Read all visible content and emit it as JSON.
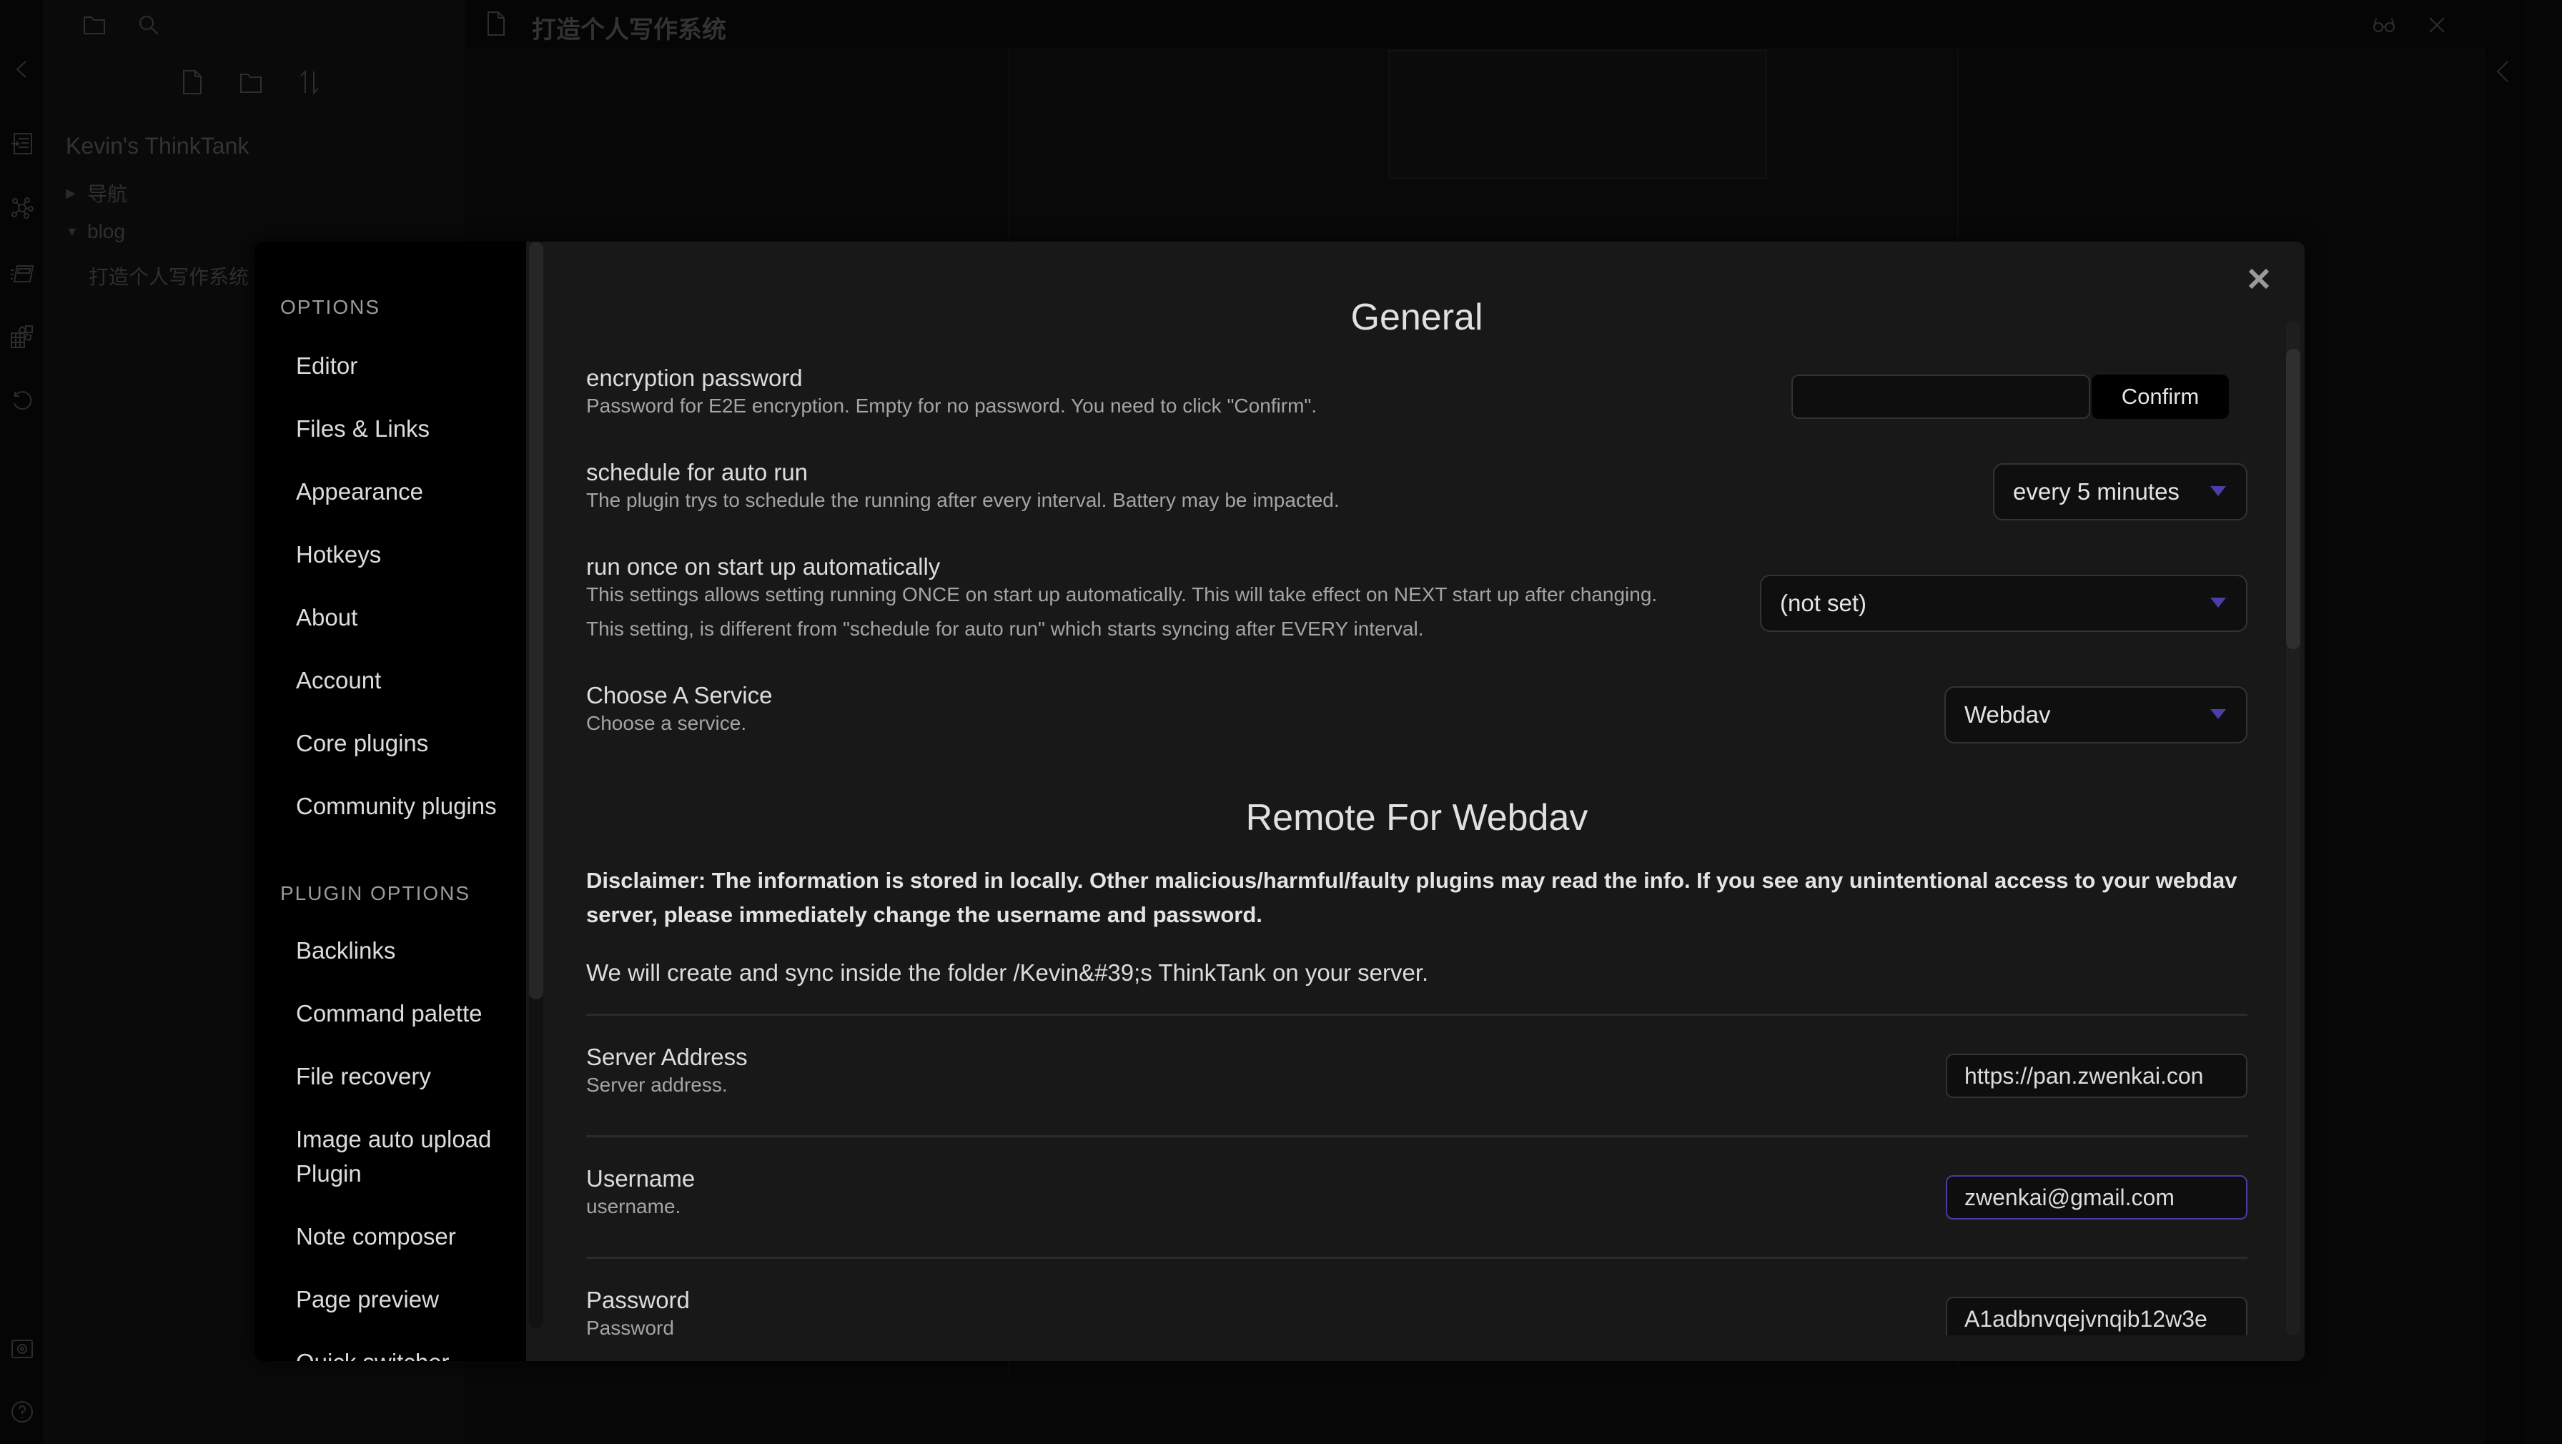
{
  "app": {
    "tab_title": "打造个人写作系统",
    "vault_name": "Kevin's ThinkTank",
    "tree": [
      {
        "label": "导航",
        "expanded": false
      },
      {
        "label": "blog",
        "expanded": true
      },
      {
        "label": "打造个人写作系统",
        "expanded": null
      }
    ]
  },
  "ribbon": {
    "icons": [
      "collapse-left-icon",
      "open-quick-switcher-icon",
      "graph-view-icon",
      "slides-icon",
      "plugin-blocks-icon",
      "history-icon",
      "vault-icon",
      "help-icon"
    ]
  },
  "settings_nav": {
    "options_heading": "OPTIONS",
    "options": [
      "Editor",
      "Files & Links",
      "Appearance",
      "Hotkeys",
      "About",
      "Account",
      "Core plugins",
      "Community plugins"
    ],
    "plugin_heading": "PLUGIN OPTIONS",
    "plugins": [
      "Backlinks",
      "Command palette",
      "File recovery",
      "Image auto upload Plugin",
      "Note composer",
      "Page preview",
      "Quick switcher"
    ]
  },
  "settings": {
    "general_title": "General",
    "encryption": {
      "name": "encryption password",
      "desc": "Password for E2E encryption. Empty for no password. You need to click \"Confirm\".",
      "value": "",
      "button": "Confirm"
    },
    "schedule": {
      "name": "schedule for auto run",
      "desc": "The plugin trys to schedule the running after every interval. Battery may be impacted.",
      "selected": "every 5 minutes"
    },
    "startup": {
      "name": "run once on start up automatically",
      "desc1": "This settings allows setting running ONCE on start up automatically. This will take effect on NEXT start up after changing.",
      "desc2": "This setting, is different from \"schedule for auto run\" which starts syncing after EVERY interval.",
      "selected": "(not set)"
    },
    "service": {
      "name": "Choose A Service",
      "desc": "Choose a service.",
      "selected": "Webdav"
    },
    "remote_title": "Remote For Webdav",
    "disclaimer": "Disclaimer: The information is stored in locally. Other malicious/harmful/faulty plugins may read the info. If you see any unintentional access to your webdav server, please immediately change the username and password.",
    "folder_note": "We will create and sync inside the folder /Kevin&#39;s ThinkTank on your server.",
    "server": {
      "name": "Server Address",
      "desc": "Server address.",
      "value": "https://pan.zwenkai.con"
    },
    "username": {
      "name": "Username",
      "desc": "username.",
      "value": "zwenkai@gmail.com"
    },
    "password": {
      "name": "Password",
      "desc": "Password",
      "value": "A1adbnvqejvnqib12w3e"
    }
  },
  "colors": {
    "accent": "#483c9c",
    "modal_bg": "#181818",
    "nav_bg": "#000000"
  }
}
